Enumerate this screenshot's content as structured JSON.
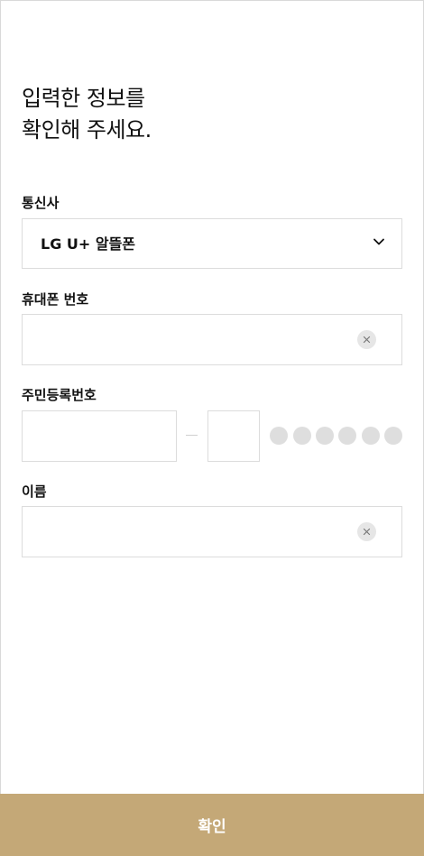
{
  "page": {
    "title_line1": "입력한 정보를",
    "title_line2": "확인해 주세요."
  },
  "carrier": {
    "label": "통신사",
    "selected": "LG U+ 알뜰폰",
    "icon": "chevron-down-icon"
  },
  "phone": {
    "label": "휴대폰 번호",
    "value": "",
    "clear_icon": "close-icon"
  },
  "rrn": {
    "label": "주민등록번호",
    "front_value": "",
    "back_first_digit": "",
    "masked_digit_count": 6
  },
  "name": {
    "label": "이름",
    "value": "",
    "clear_icon": "close-icon"
  },
  "confirm": {
    "label": "확인"
  },
  "colors": {
    "accent": "#c4a877",
    "border": "#dcdcdc",
    "mask_dot": "#dedede",
    "clear_bg": "#e6e6e6"
  }
}
